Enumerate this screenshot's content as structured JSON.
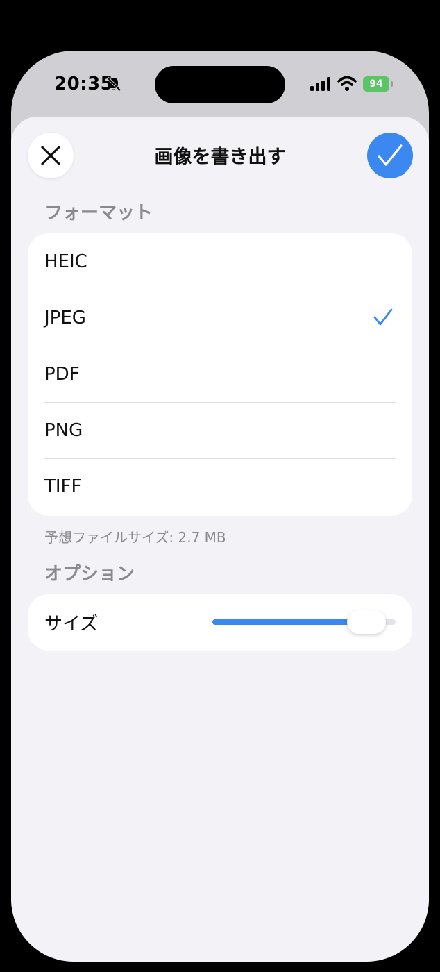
{
  "status_bar": {
    "time": "20:35",
    "battery": "94"
  },
  "sheet": {
    "title": "画像を書き出す",
    "close_icon": "close-icon",
    "done_icon": "checkmark-icon"
  },
  "format_section": {
    "header": "フォーマット",
    "options": [
      {
        "label": "HEIC",
        "selected": false
      },
      {
        "label": "JPEG",
        "selected": true
      },
      {
        "label": "PDF",
        "selected": false
      },
      {
        "label": "PNG",
        "selected": false
      },
      {
        "label": "TIFF",
        "selected": false
      }
    ],
    "file_size_text": "予想ファイルサイズ: 2.7 MB"
  },
  "options_section": {
    "header": "オプション",
    "size_label": "サイズ",
    "size_slider_fraction": 0.84
  },
  "colors": {
    "accent": "#3a88f0",
    "sheet_background": "#f2f2f7",
    "secondary_text": "#8a8a8e",
    "battery": "#5ac466"
  }
}
